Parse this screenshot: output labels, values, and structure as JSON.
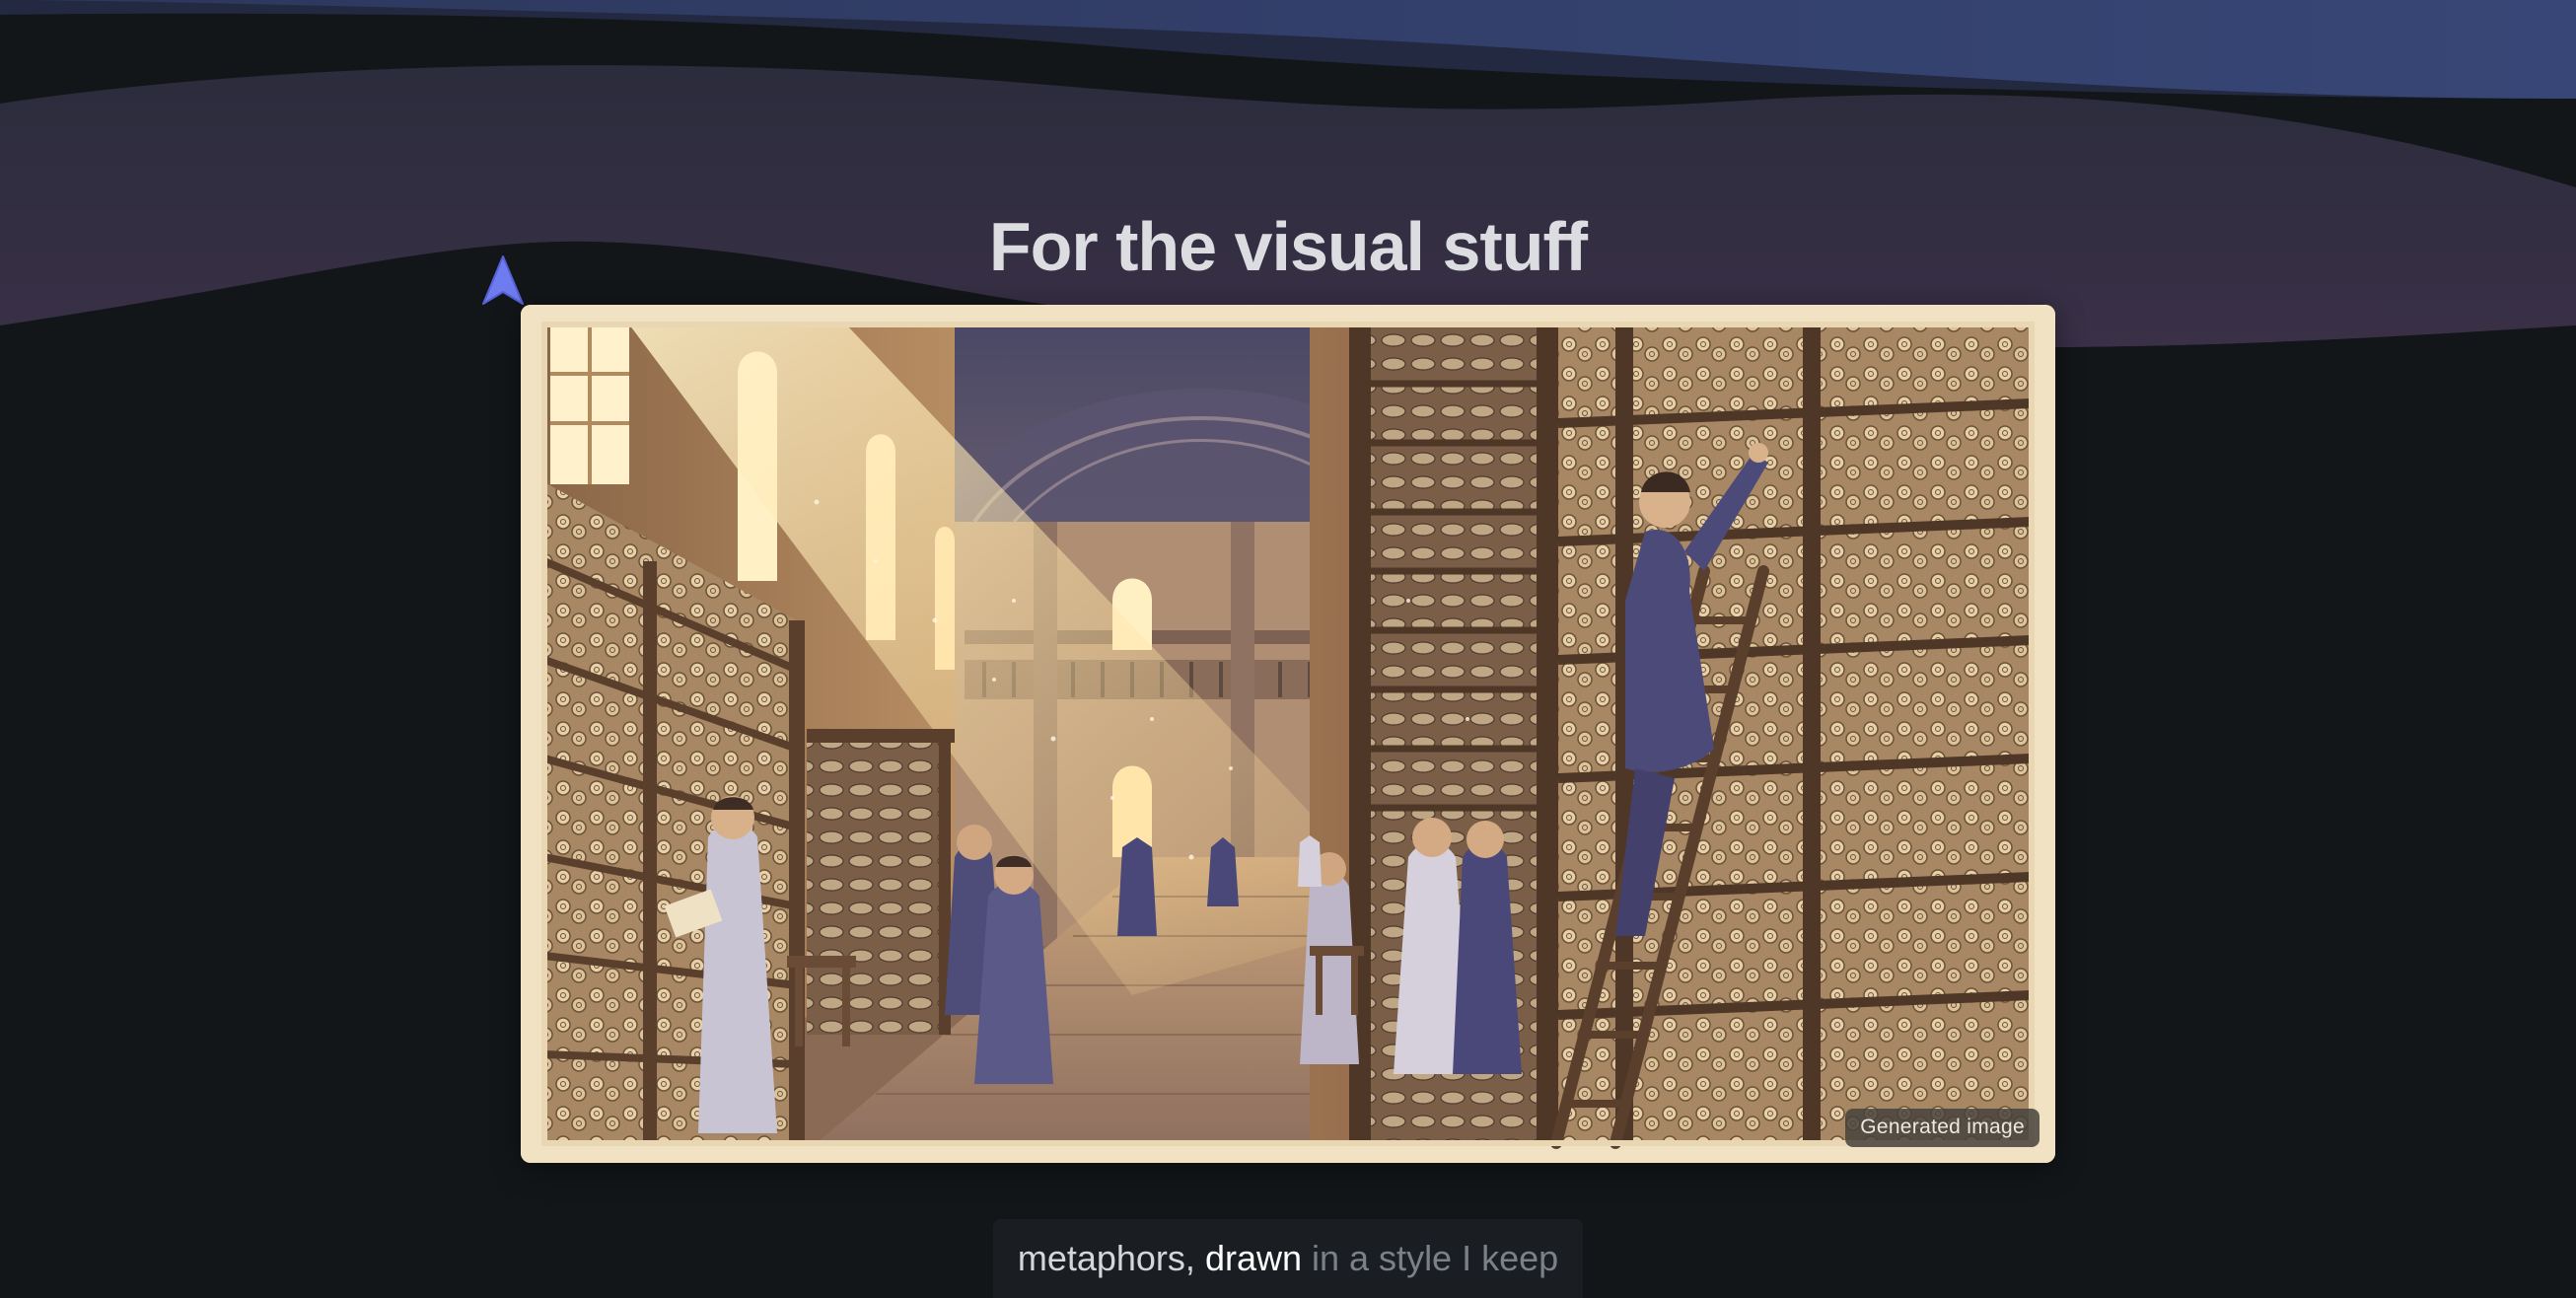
{
  "heading": "For the visual stuff",
  "image": {
    "badge": "Generated image"
  },
  "caption": {
    "part1": "metaphors,",
    "part2": "drawn",
    "part3": "in a style I keep"
  },
  "colors": {
    "background": "#131619",
    "wave_blue": "#3a4a7a",
    "wave_purple": "#3d3552",
    "cursor": "#6f7cf0",
    "card": "#f1e2c4"
  },
  "icons": {
    "cursor": "arrow-cursor-icon"
  }
}
